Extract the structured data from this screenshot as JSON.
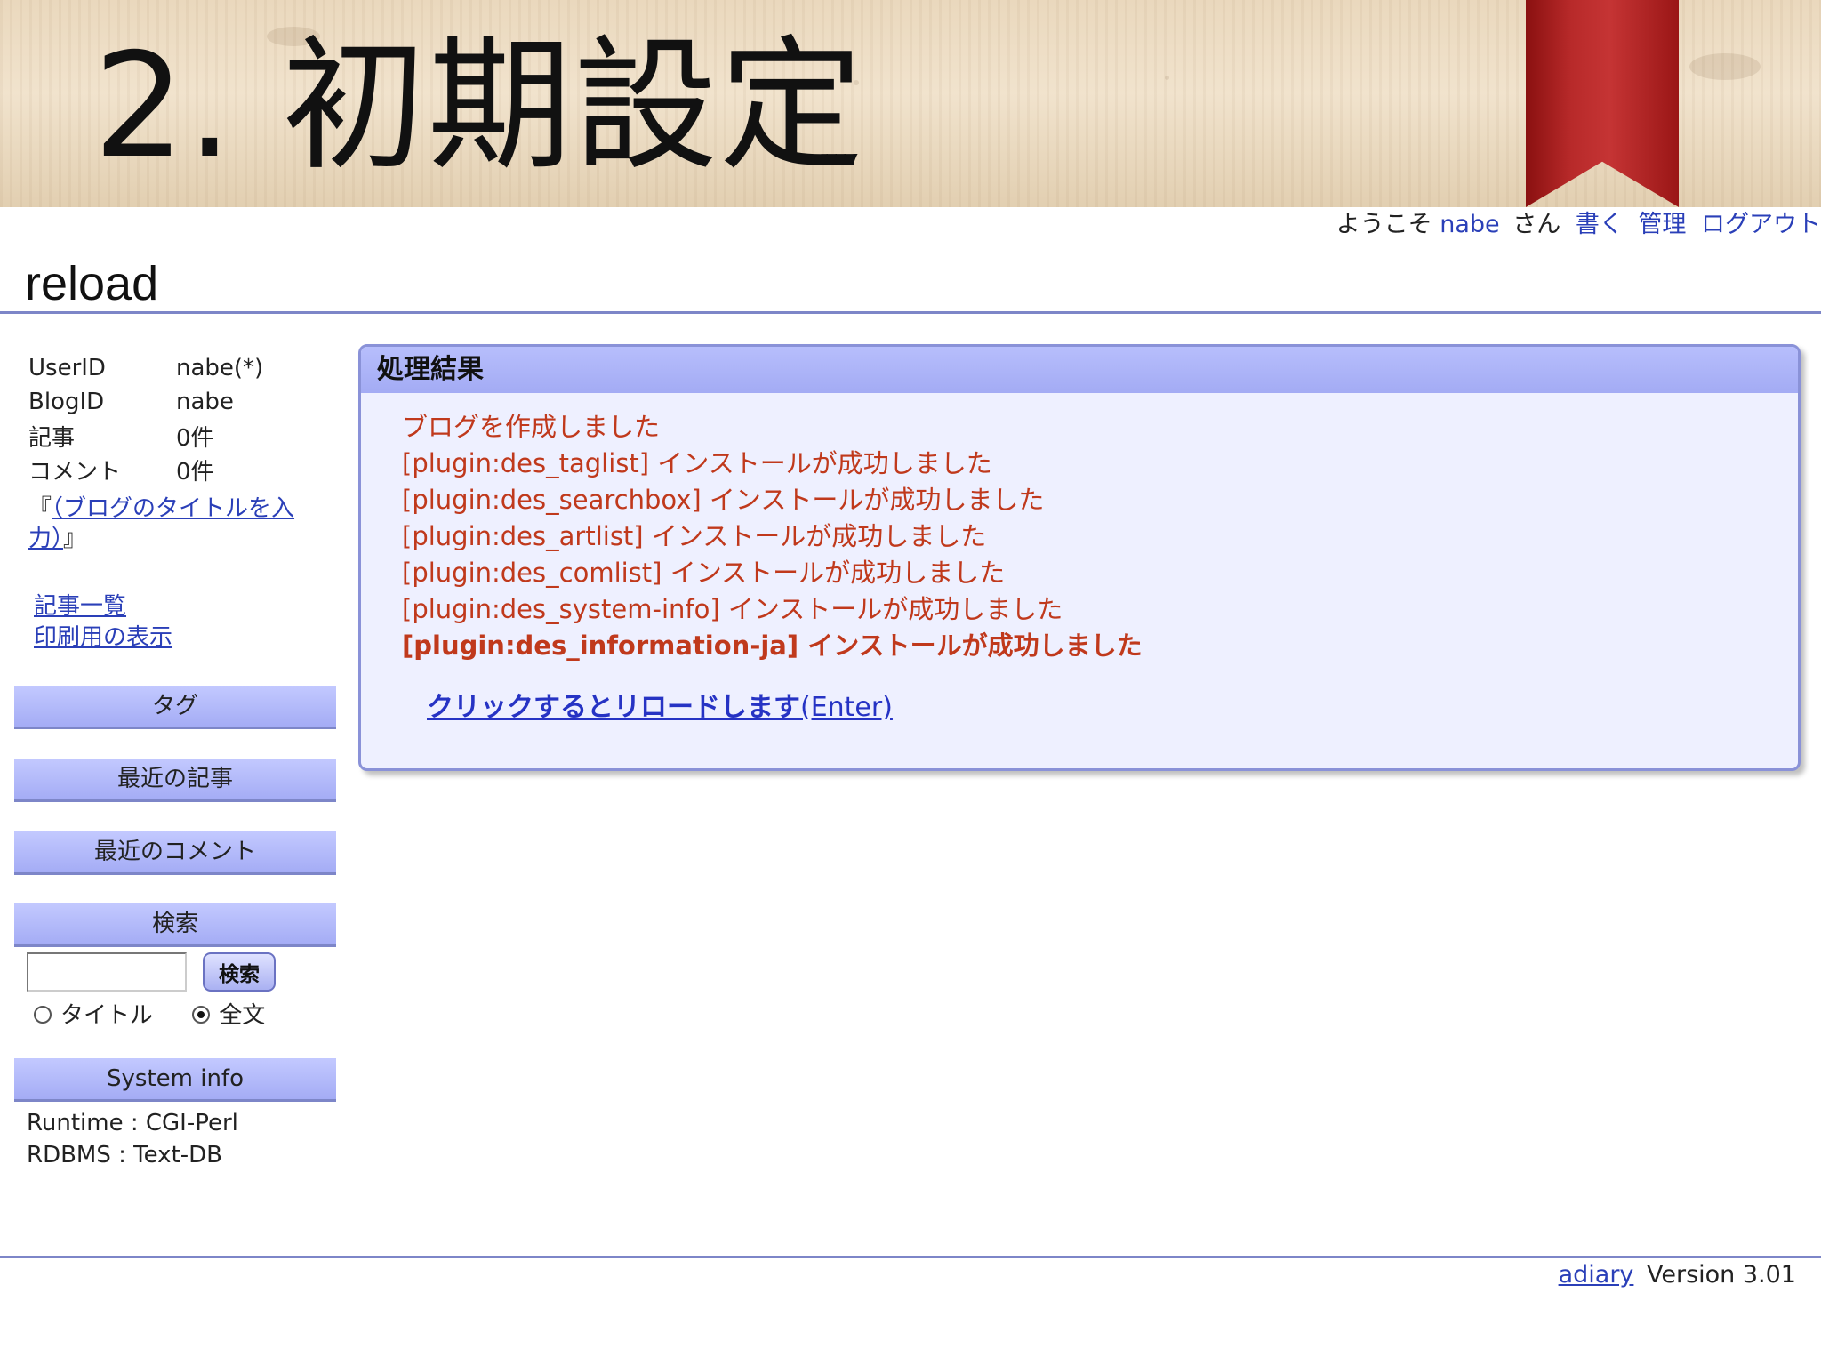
{
  "slide": {
    "title": "2. 初期設定"
  },
  "userbar": {
    "welcome": "ようこそ",
    "user": "nabe",
    "suffix": "さん",
    "write": "書く",
    "admin": "管理",
    "logout": "ログアウト"
  },
  "page": {
    "title": "reload"
  },
  "sidebar": {
    "info": [
      {
        "label": "UserID",
        "value": "nabe(*)"
      },
      {
        "label": "BlogID",
        "value": "nabe"
      },
      {
        "label": "記事",
        "value": "0件"
      },
      {
        "label": "コメント",
        "value": "0件"
      }
    ],
    "blog_name_open": "『",
    "blog_name_link": "（ブログのタイトルを入力）",
    "blog_name_close": "』",
    "links": [
      "記事一覧",
      "印刷用の表示"
    ],
    "headings": {
      "tags": "タグ",
      "recent_articles": "最近の記事",
      "recent_comments": "最近のコメント",
      "search": "検索",
      "system_info": "System info"
    },
    "search": {
      "input_value": "",
      "button_label": "検索",
      "radio_title": "タイトル",
      "radio_fulltext": "全文",
      "selected": "全文"
    },
    "system_info": [
      "Runtime : CGI-Perl",
      "RDBMS : Text-DB"
    ]
  },
  "result": {
    "heading": "処理結果",
    "messages": [
      "ブログを作成しました",
      "[plugin:des_taglist] インストールが成功しました",
      "[plugin:des_searchbox] インストールが成功しました",
      "[plugin:des_artlist] インストールが成功しました",
      "[plugin:des_comlist] インストールが成功しました",
      "[plugin:des_system-info] インストールが成功しました"
    ],
    "last_message": "[plugin:des_information-ja] インストールが成功しました",
    "reload_link": "クリックするとリロードします",
    "reload_link_suffix": "(Enter)"
  },
  "footer": {
    "link": "adiary",
    "version": "Version 3.01"
  },
  "colors": {
    "accent_blue": "#a4acf5",
    "rule": "#7d86c8",
    "message_red": "#c0391c",
    "link": "#2a3fb8",
    "bookmark_red": "#b82a2a"
  }
}
